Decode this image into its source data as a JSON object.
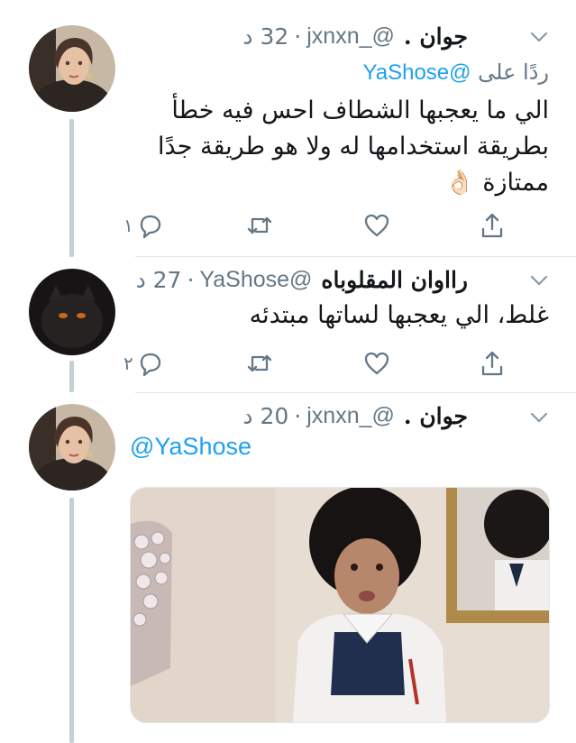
{
  "tweets": [
    {
      "name": "جوان .",
      "handle": "@_jxnxn",
      "time": "32 د",
      "reply_prefix": "ردًا على",
      "reply_mention": "@YaShose",
      "text_lines": [
        "الي ما يعجبها الشطاف احس فيه خطأ",
        "بطريقة استخدامها له ولا هو طريقة جدًا",
        "ممتازة 👌🏻"
      ],
      "reply_count": "١",
      "avatar_icon": "woman-portrait"
    },
    {
      "name": "رااوان المقلوباه",
      "handle": "@YaShose",
      "time": "27 د",
      "text": "غلط، الي يعجبها لساتها مبتدئه",
      "reply_count": "٢",
      "avatar_icon": "black-cat"
    },
    {
      "name": "جوان .",
      "handle": "@_jxnxn",
      "time": "20 د",
      "mention": "@YaShose",
      "avatar_icon": "woman-portrait",
      "media": "photo-child-in-afro"
    }
  ],
  "colors": {
    "accent": "#1da1f2",
    "secondary_text": "#657786",
    "icon": "#657786",
    "thread_line": "#c4cfd6",
    "divider": "#e1e8ed"
  },
  "icons": [
    "reply-icon",
    "retweet-icon",
    "like-icon",
    "share-icon",
    "chevron-down-icon"
  ]
}
